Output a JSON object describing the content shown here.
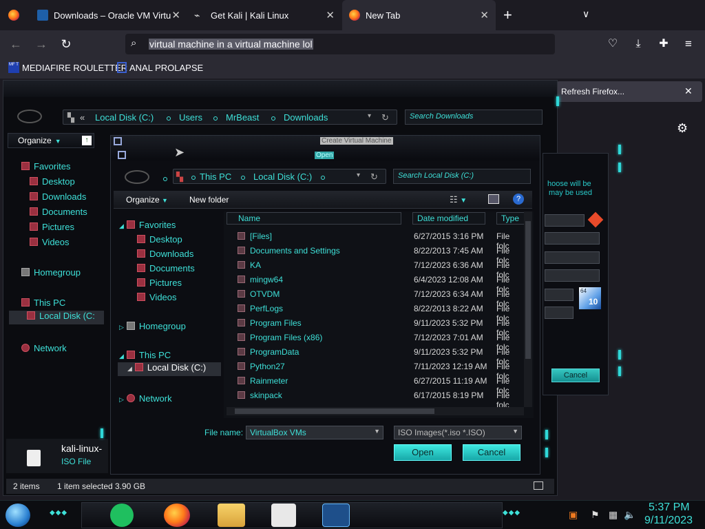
{
  "browser": {
    "tabs": [
      {
        "label": "Downloads – Oracle VM VirtualBox"
      },
      {
        "label": "Get Kali | Kali Linux"
      },
      {
        "label": "New Tab"
      }
    ],
    "new_tab_symbol": "+",
    "tab_list_symbol": "∨",
    "url_value": "virtual machine in a virtual machine lol",
    "bookmarks": [
      {
        "icon_text": "MF T",
        "label": "MEDIAFIRE ROULETTER"
      },
      {
        "label": "ANAL PROLAPSE"
      }
    ],
    "refresh_firefox": "Refresh Firefox...",
    "close_symbol": "✕",
    "icons": [
      "back-icon",
      "forward-icon",
      "reload-icon",
      "search-icon",
      "pocket-icon",
      "download-icon",
      "extensions-icon",
      "menu-icon",
      "settings-icon"
    ]
  },
  "explorer": {
    "address": {
      "prefix": "«",
      "crumbs": [
        "Local Disk (C:)",
        "Users",
        "MrBeast",
        "Downloads"
      ]
    },
    "search_placeholder": "Search Downloads",
    "organize": "Organize",
    "nav": {
      "favorites": "Favorites",
      "favorites_items": [
        "Desktop",
        "Downloads",
        "Documents",
        "Pictures",
        "Videos"
      ],
      "homegroup": "Homegroup",
      "this_pc": "This PC",
      "local_disk": "Local Disk (C:",
      "network": "Network"
    },
    "preview": {
      "name": "kali-linux-",
      "type": "ISO File"
    },
    "status": {
      "count": "2 items",
      "selected": "1 item selected",
      "size": "3.90 GB"
    }
  },
  "vbox_dialog": {
    "title": "Create Virtual Machine",
    "text1": "hoose will be",
    "text2": "may be used",
    "cancel": "Cancel",
    "badge_top": "64",
    "badge_bottom": "10"
  },
  "open_dialog": {
    "title": "Open",
    "address": {
      "crumbs": [
        "This PC",
        "Local Disk (C:)"
      ]
    },
    "search_placeholder": "Search Local Disk (C:)",
    "organize": "Organize",
    "new_folder": "New folder",
    "nav": {
      "favorites": "Favorites",
      "favorites_items": [
        "Desktop",
        "Downloads",
        "Documents",
        "Pictures",
        "Videos"
      ],
      "homegroup": "Homegroup",
      "this_pc": "This PC",
      "local_disk": "Local Disk (C:)",
      "network": "Network"
    },
    "columns": {
      "name": "Name",
      "date": "Date modified",
      "type": "Type"
    },
    "files": [
      {
        "name": "[Files]",
        "date": "6/27/2015 3:16 PM",
        "type": "File folc"
      },
      {
        "name": "Documents and Settings",
        "date": "8/22/2013 7:45 AM",
        "type": "File folc"
      },
      {
        "name": "KA",
        "date": "7/12/2023 6:36 AM",
        "type": "File folc"
      },
      {
        "name": "mingw64",
        "date": "6/4/2023 12:08 AM",
        "type": "File folc"
      },
      {
        "name": "OTVDM",
        "date": "7/12/2023 6:34 AM",
        "type": "File folc"
      },
      {
        "name": "PerfLogs",
        "date": "8/22/2013 8:22 AM",
        "type": "File folc"
      },
      {
        "name": "Program Files",
        "date": "9/11/2023 5:32 PM",
        "type": "File folc"
      },
      {
        "name": "Program Files (x86)",
        "date": "7/12/2023 7:01 AM",
        "type": "File folc"
      },
      {
        "name": "ProgramData",
        "date": "9/11/2023 5:32 PM",
        "type": "File folc"
      },
      {
        "name": "Python27",
        "date": "7/11/2023 12:19 AM",
        "type": "File folc"
      },
      {
        "name": "Rainmeter",
        "date": "6/27/2015 11:19 AM",
        "type": "File folc"
      },
      {
        "name": "skinpack",
        "date": "6/17/2015 8:19 PM",
        "type": "File folc"
      }
    ],
    "file_name_label": "File name:",
    "file_name_value": "VirtualBox VMs",
    "file_type_value": "ISO Images(*.iso *.ISO)",
    "open_button": "Open",
    "cancel_button": "Cancel"
  },
  "taskbar": {
    "time": "5:37 PM",
    "date": "9/11/2023"
  },
  "colors": {
    "accent": "#3ee0d8",
    "chrome_dark": "#1c1b22",
    "chrome_mid": "#2b2a33"
  }
}
